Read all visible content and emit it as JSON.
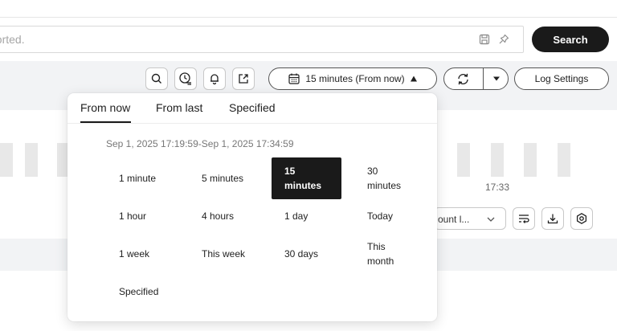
{
  "search": {
    "placeholder": "ported.",
    "button_label": "Search"
  },
  "toolbar": {
    "time_range_label": "15 minutes (From now)",
    "log_settings_label": "Log Settings"
  },
  "histogram": {
    "time_label": "17:33"
  },
  "results": {
    "count_select_label": "ount l..."
  },
  "time_picker": {
    "tabs": [
      "From now",
      "From last",
      "Specified"
    ],
    "active_tab": "From now",
    "range_text": "Sep 1, 2025 17:19:59-Sep 1, 2025 17:34:59",
    "options": [
      "1 minute",
      "5 minutes",
      "15 minutes",
      "30 minutes",
      "1 hour",
      "4 hours",
      "1 day",
      "Today",
      "1 week",
      "This week",
      "30 days",
      "This month",
      "Specified"
    ],
    "selected": "15 minutes"
  },
  "colors": {
    "accent": "#1a1a1a",
    "background": "#f2f3f5",
    "surface": "#ffffff"
  }
}
